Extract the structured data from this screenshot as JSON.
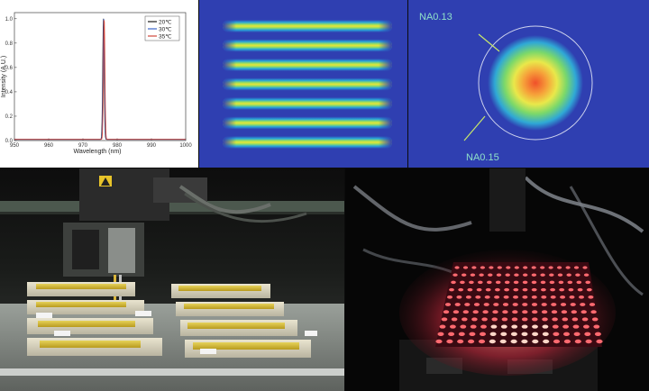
{
  "chart_data": {
    "type": "line",
    "xlabel": "Wavelength (nm)",
    "ylabel": "Intensity (A.U.)",
    "xlim": [
      950,
      1000
    ],
    "ylim": [
      0,
      1.05
    ],
    "x_ticks": [
      "950",
      "960",
      "970",
      "980",
      "990",
      "1000"
    ],
    "y_ticks": [
      "0.0",
      "0.2",
      "0.4",
      "0.6",
      "0.8",
      "1.0"
    ],
    "grid": false,
    "legend": "top-right",
    "series": [
      {
        "name": "20℃",
        "color": "#1a1a1a",
        "peak": 976.0,
        "fwhm": 0.5
      },
      {
        "name": "30℃",
        "color": "#3a63c9",
        "peak": 976.1,
        "fwhm": 0.5
      },
      {
        "name": "35℃",
        "color": "#d0463a",
        "peak": 976.2,
        "fwhm": 0.5
      }
    ]
  },
  "na_labels": {
    "inner": "NA0.13",
    "outer": "NA0.15"
  },
  "beam_rows": 7
}
